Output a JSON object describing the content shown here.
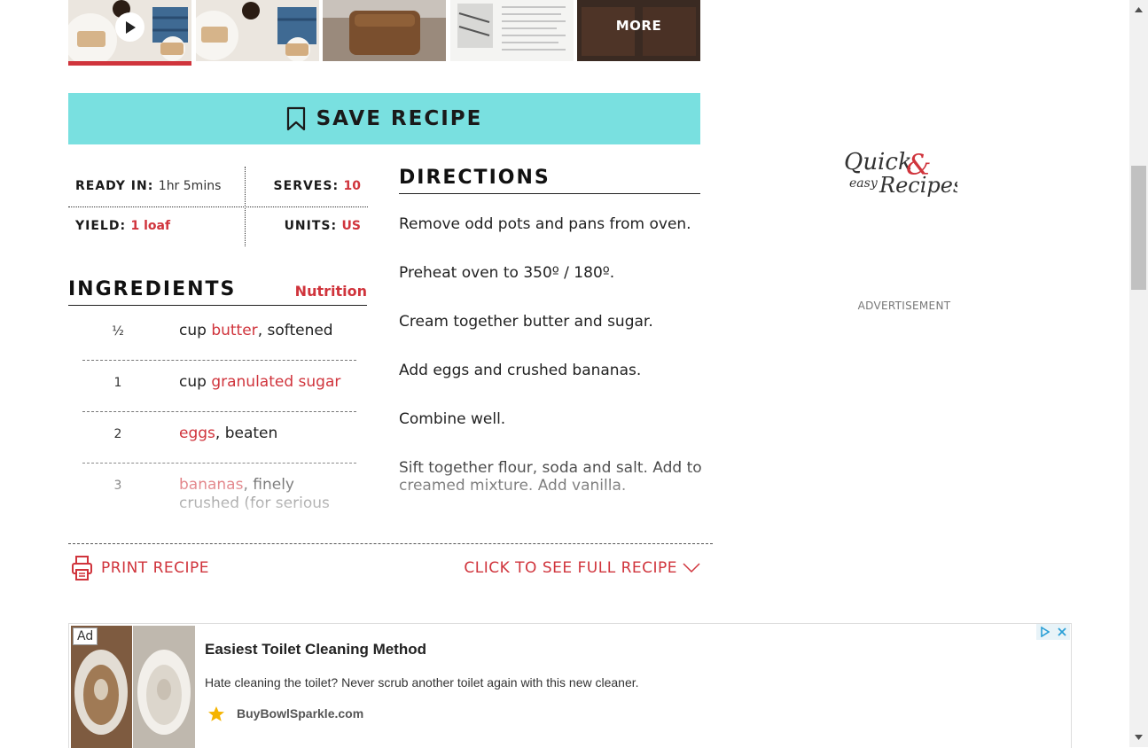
{
  "gallery": {
    "more_label": "MORE",
    "thumbnails": [
      "video-thumbnail",
      "photo-thumbnail",
      "photo-thumbnail",
      "photo-thumbnail",
      "more-thumbnail"
    ]
  },
  "save_button": {
    "label": "SAVE RECIPE",
    "icon": "bookmark-icon"
  },
  "meta": {
    "ready_in_label": "READY IN:",
    "ready_in_value": "1hr 5mins",
    "serves_label": "SERVES:",
    "serves_value": "10",
    "yield_label": "YIELD:",
    "yield_value": "1 loaf",
    "units_label": "UNITS:",
    "units_value": "US"
  },
  "ingredients": {
    "title": "INGREDIENTS",
    "nutrition_link": "Nutrition",
    "items": [
      {
        "qty": "½",
        "pre": "cup ",
        "link": "butter",
        "post": ", softened"
      },
      {
        "qty": "1",
        "pre": "cup ",
        "link": "granulated sugar",
        "post": ""
      },
      {
        "qty": "2",
        "pre": "",
        "link": "eggs",
        "post": ", beaten"
      },
      {
        "qty": "3",
        "pre": "",
        "link": "bananas",
        "post": ", finely crushed (for serious"
      }
    ]
  },
  "directions": {
    "title": "DIRECTIONS",
    "steps": [
      "Remove odd pots and pans from oven.",
      "Preheat oven to 350º / 180º.",
      "Cream together butter and sugar.",
      "Add eggs and crushed bananas.",
      "Combine well.",
      "Sift together flour, soda and salt. Add to creamed mixture. Add vanilla."
    ]
  },
  "actions": {
    "print_label": "PRINT RECIPE",
    "full_recipe_label": "CLICK TO SEE FULL RECIPE"
  },
  "sidebar": {
    "logo_line1": "Quick",
    "logo_amp": "&",
    "logo_line2a": "easy",
    "logo_line2b": "Recipes",
    "advertisement_label": "ADVERTISEMENT"
  },
  "ad": {
    "badge": "Ad",
    "title": "Easiest Toilet Cleaning Method",
    "description": "Hate cleaning the toilet? Never scrub another toilet again with this new cleaner.",
    "domain": "BuyBowlSparkle.com"
  },
  "colors": {
    "accent_red": "#d0343c",
    "save_button_bg": "#79e0e0",
    "ad_star": "#f5b400"
  }
}
